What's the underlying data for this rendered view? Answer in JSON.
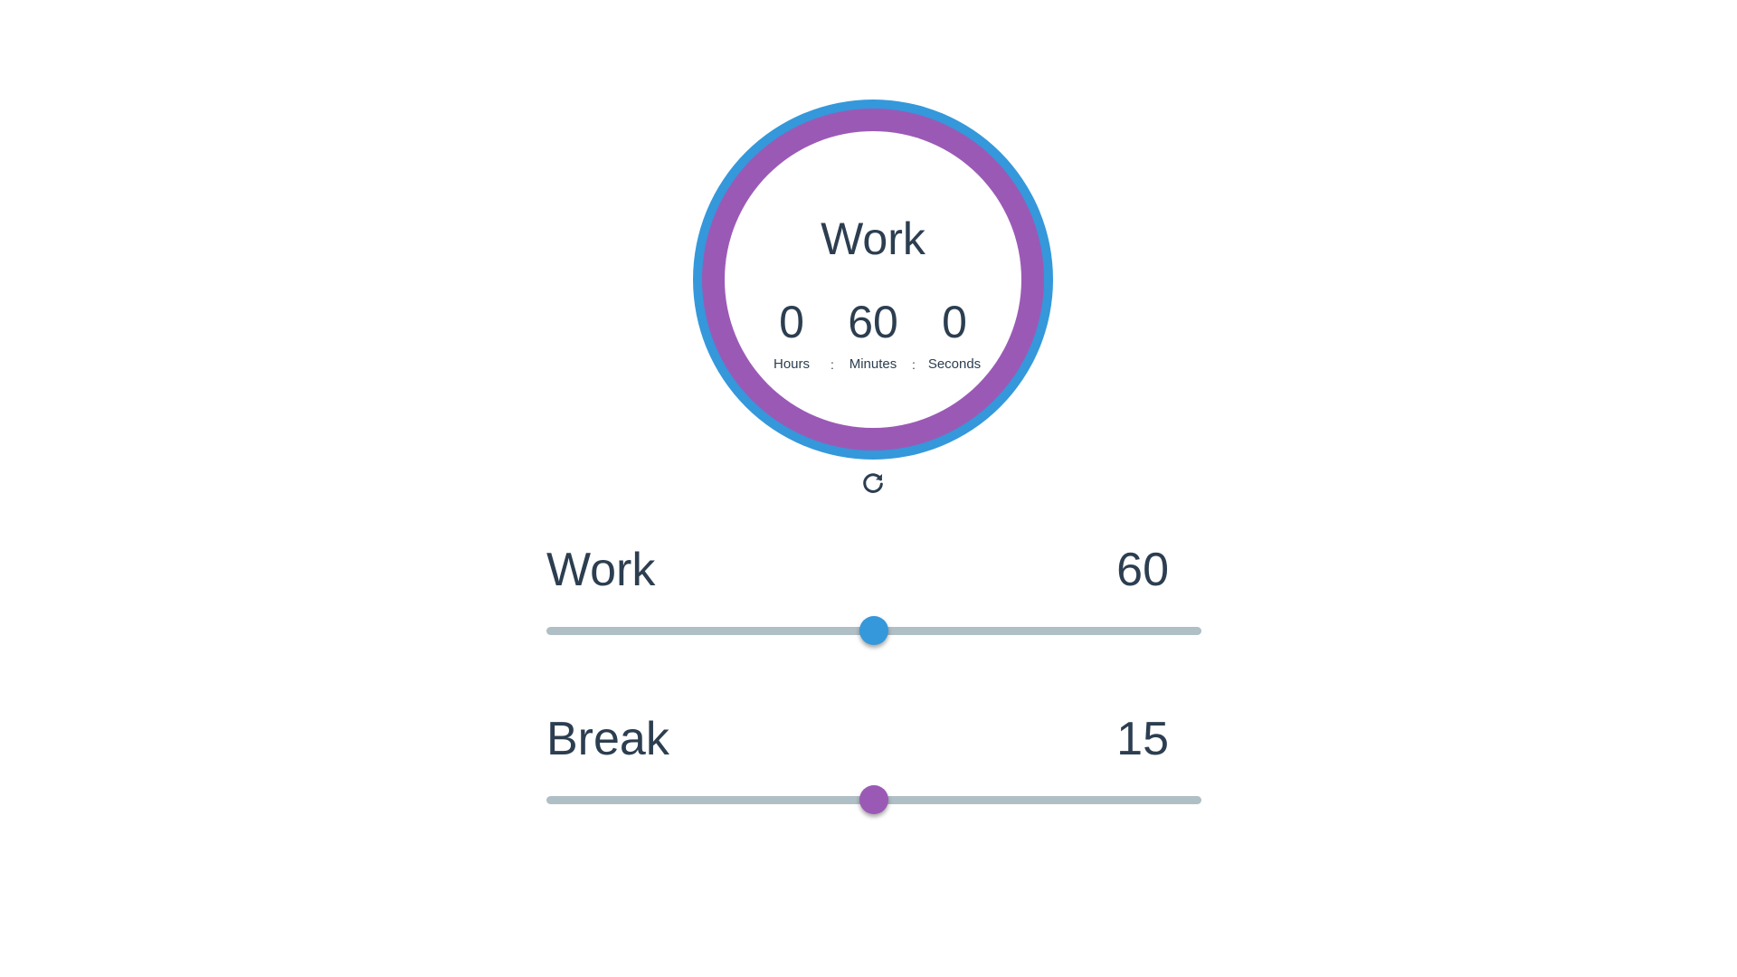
{
  "timer": {
    "mode": "Work",
    "hours": "0",
    "minutes": "60",
    "seconds": "0",
    "hours_label": "Hours",
    "minutes_label": "Minutes",
    "seconds_label": "Seconds",
    "separator": ":",
    "ring_outer_color": "#3498db",
    "ring_inner_color": "#9b59b6"
  },
  "reset": {
    "icon": "refresh-icon"
  },
  "settings": {
    "work": {
      "label": "Work",
      "value": "60",
      "slider_fraction": 0.5,
      "thumb_color": "#3498db"
    },
    "break": {
      "label": "Break",
      "value": "15",
      "slider_fraction": 0.5,
      "thumb_color": "#9b59b6"
    }
  },
  "colors": {
    "text": "#2c3e50",
    "track": "#b0bec5",
    "background": "#ffffff"
  }
}
